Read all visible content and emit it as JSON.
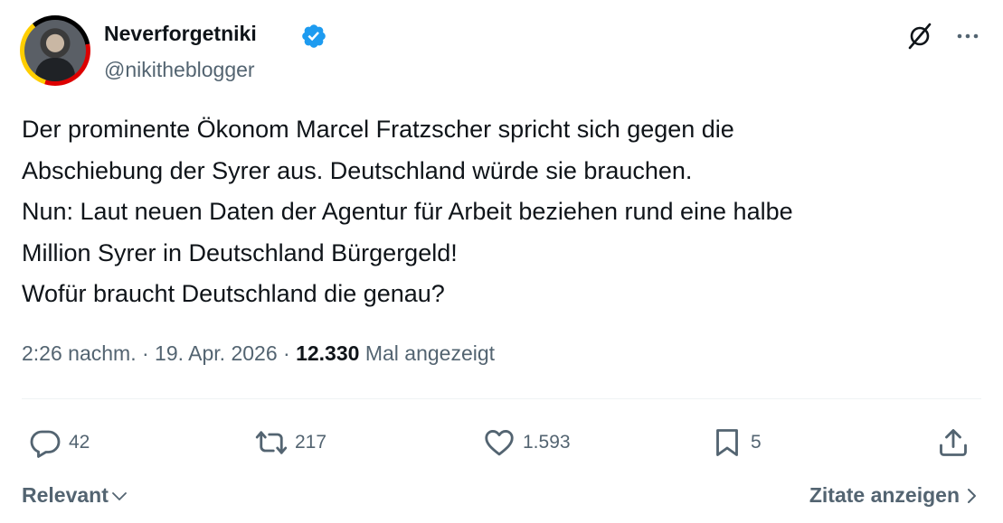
{
  "author": {
    "name": "Neverforgetniki",
    "handle": "@nikitheblogger",
    "verified": true,
    "verified_color": "#1d9bf0"
  },
  "tweet": {
    "lines": [
      "Der prominente Ökonom Marcel Fratzscher spricht sich gegen die",
      "Abschiebung der Syrer aus. Deutschland würde sie brauchen.",
      "Nun: Laut neuen Daten der Agentur für Arbeit beziehen rund eine halbe",
      "Million Syrer in Deutschland Bürgergeld!",
      "Wofür braucht Deutschland die genau?"
    ]
  },
  "meta": {
    "time": "2:26 nachm.",
    "separator": " · ",
    "date": "19. Apr. 2026",
    "views_count": "12.330",
    "views_label": "Mal angezeigt"
  },
  "actions": {
    "replies": "42",
    "reposts": "217",
    "likes": "1.593",
    "bookmarks": "5"
  },
  "footer": {
    "sort_label": "Relevant",
    "quotes_label": "Zitate anzeigen"
  },
  "icons": [
    "grok-icon",
    "more-icon",
    "reply-icon",
    "repost-icon",
    "like-icon",
    "bookmark-icon",
    "share-icon",
    "chevron-down-icon",
    "chevron-right-icon",
    "verified-badge-icon"
  ]
}
